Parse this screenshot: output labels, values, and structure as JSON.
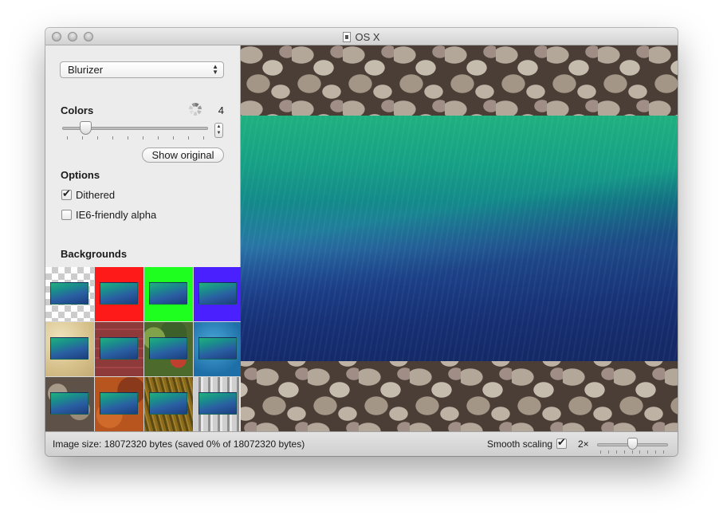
{
  "window": {
    "title": "OS X"
  },
  "sidebar": {
    "algorithm": {
      "selected": "Blurizer"
    },
    "colors": {
      "label": "Colors",
      "count": "4",
      "slider_fraction": 0.13
    },
    "show_original_label": "Show original",
    "options": {
      "label": "Options",
      "dithered": {
        "label": "Dithered",
        "checked": true
      },
      "ie6_alpha": {
        "label": "IE6-friendly alpha",
        "checked": false
      }
    },
    "backgrounds": {
      "label": "Backgrounds",
      "tiles": [
        "checkerboard",
        "red",
        "green",
        "blue",
        "sand",
        "brick",
        "leaves",
        "water",
        "rocks",
        "rust",
        "grass",
        "spikes"
      ]
    }
  },
  "status": {
    "image_size_text": "Image size: 18072320 bytes (saved 0% of 18072320 bytes)",
    "smooth_scaling": {
      "label": "Smooth scaling",
      "checked": true
    },
    "zoom": {
      "label": "2×",
      "slider_fraction": 0.5
    }
  },
  "colors": {
    "tile_red": "#ff1a1a",
    "tile_green": "#1fff1f",
    "tile_blue": "#4a20ff"
  }
}
